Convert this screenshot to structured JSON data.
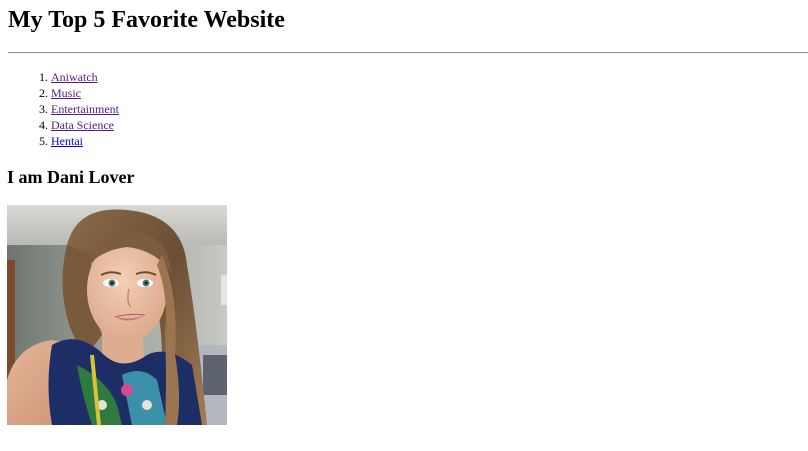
{
  "header": {
    "title": "My Top 5 Favorite Website"
  },
  "favorites": {
    "items": [
      {
        "label": "Aniwatch",
        "visited": true
      },
      {
        "label": "Music",
        "visited": true
      },
      {
        "label": "Entertainment",
        "visited": true
      },
      {
        "label": "Data Science",
        "visited": true
      },
      {
        "label": "Hentai",
        "visited": false
      }
    ]
  },
  "section": {
    "heading": "I am Dani Lover"
  },
  "photo": {
    "subject": "portrait-selfie-photo"
  },
  "colors": {
    "visited_link": "#551a8b",
    "unvisited_link": "#0000ee",
    "rule": "#9a9a9a"
  }
}
